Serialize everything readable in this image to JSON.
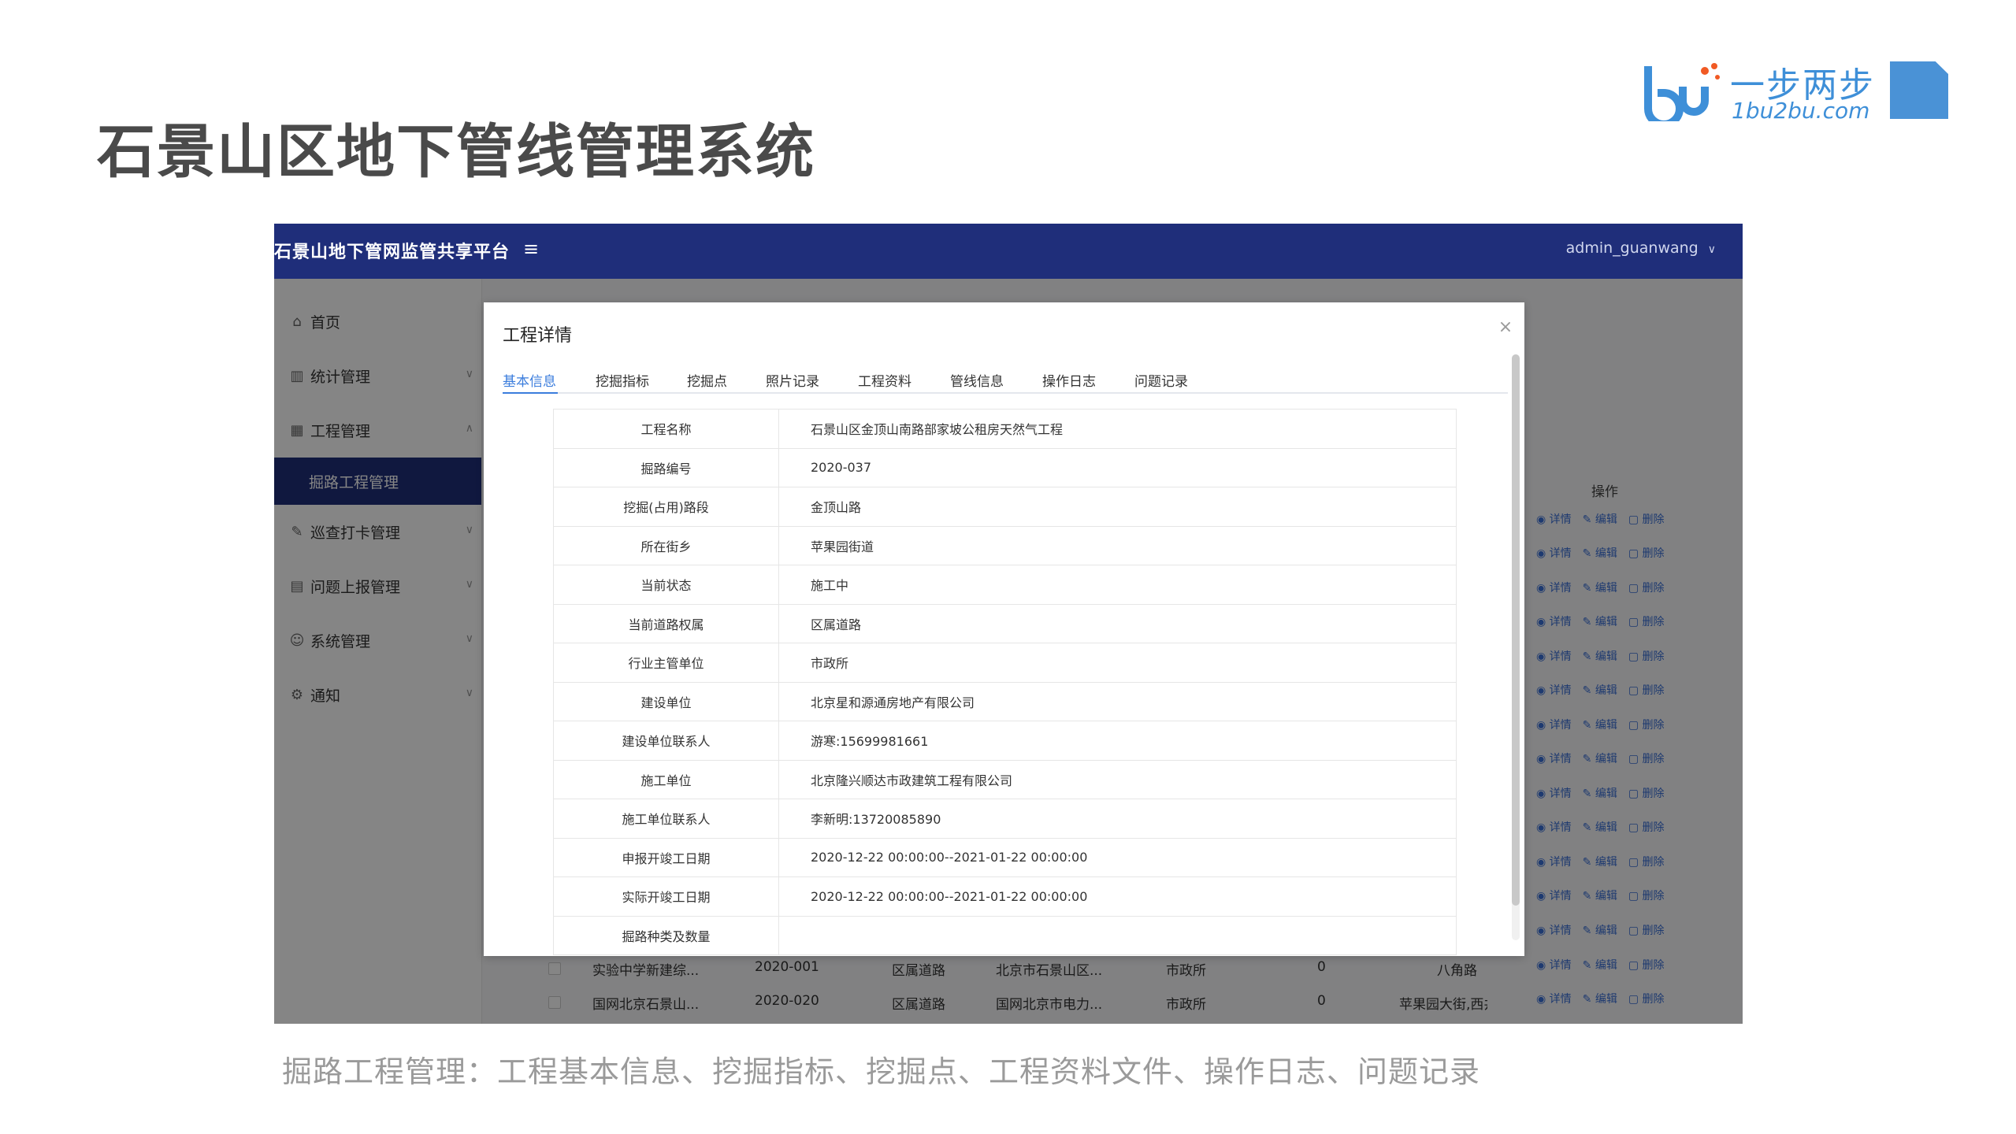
{
  "slide": {
    "title": "石景山区地下管线管理系统",
    "caption": "掘路工程管理：工程基本信息、挖掘指标、挖掘点、工程资料文件、操作日志、问题记录"
  },
  "logo": {
    "cn": "一步两步",
    "en": "1bu2bu.com",
    "color": "#3e8fd8",
    "accent": "#f15a24"
  },
  "app": {
    "brand": "石景山地下管网监管共享平台",
    "user": "admin_guanwang",
    "theme_color": "#1f2e7a",
    "sidebar": [
      {
        "label": "首页",
        "icon": "home-icon"
      },
      {
        "label": "统计管理",
        "icon": "chart-icon",
        "caret": "down"
      },
      {
        "label": "工程管理",
        "icon": "building-icon",
        "caret": "up"
      },
      {
        "label": "掘路工程管理",
        "active": true
      },
      {
        "label": "巡查打卡管理",
        "icon": "edit-icon",
        "caret": "down"
      },
      {
        "label": "问题上报管理",
        "icon": "document-icon",
        "caret": "down"
      },
      {
        "label": "系统管理",
        "icon": "users-icon",
        "caret": "down"
      },
      {
        "label": "通知",
        "icon": "gear-icon",
        "caret": "down"
      }
    ],
    "table": {
      "op_header": "操作",
      "op_detail": "详情",
      "op_edit": "编辑",
      "op_delete": "删除",
      "visible_rows": [
        {
          "name": "实验中学新建综...",
          "code": "2020-001",
          "road_type": "区属道路",
          "unit": "北京市石景山区...",
          "dept": "市政所",
          "count": "0",
          "street": "八角路"
        },
        {
          "name": "国网北京石景山...",
          "code": "2020-020",
          "road_type": "区属道路",
          "unit": "国网北京市电力...",
          "dept": "市政所",
          "count": "0",
          "street": "苹果园大街,西井"
        }
      ]
    },
    "dialog": {
      "title": "工程详情",
      "tabs": [
        "基本信息",
        "挖掘指标",
        "挖掘点",
        "照片记录",
        "工程资料",
        "管线信息",
        "操作日志",
        "问题记录"
      ],
      "active_tab": "基本信息",
      "fields": [
        {
          "key": "工程名称",
          "value": "石景山区金顶山南路部家坡公租房天然气工程"
        },
        {
          "key": "掘路编号",
          "value": "2020-037"
        },
        {
          "key": "挖掘(占用)路段",
          "value": "金顶山路"
        },
        {
          "key": "所在街乡",
          "value": "苹果园街道"
        },
        {
          "key": "当前状态",
          "value": "施工中"
        },
        {
          "key": "当前道路权属",
          "value": "区属道路"
        },
        {
          "key": "行业主管单位",
          "value": "市政所"
        },
        {
          "key": "建设单位",
          "value": "北京星和源通房地产有限公司"
        },
        {
          "key": "建设单位联系人",
          "value": "游寒:15699981661"
        },
        {
          "key": "施工单位",
          "value": "北京隆兴顺达市政建筑工程有限公司"
        },
        {
          "key": "施工单位联系人",
          "value": "李新明:13720085890"
        },
        {
          "key": "申报开竣工日期",
          "value": "2020-12-22 00:00:00--2021-01-22 00:00:00"
        },
        {
          "key": "实际开竣工日期",
          "value": "2020-12-22 00:00:00--2021-01-22 00:00:00"
        },
        {
          "key": "掘路种类及数量",
          "value": ""
        }
      ]
    }
  }
}
